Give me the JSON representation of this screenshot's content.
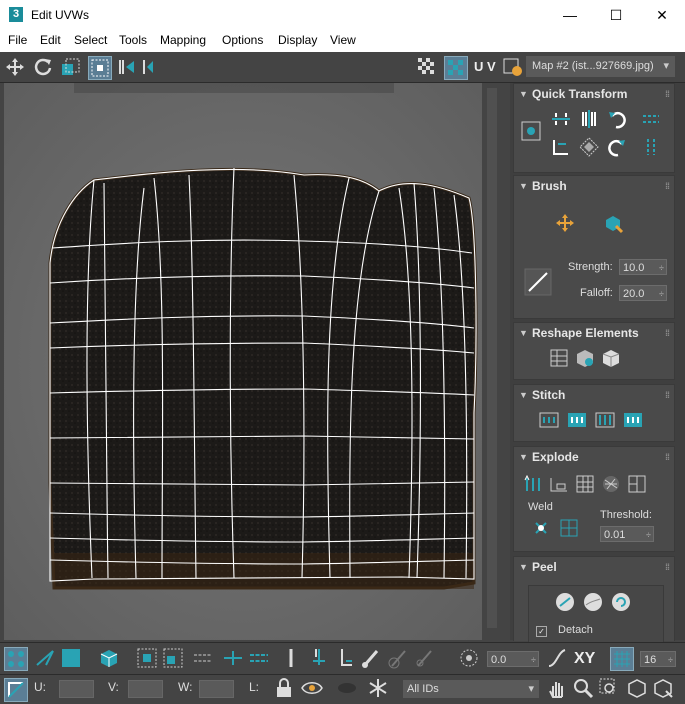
{
  "window": {
    "title": "Edit UVWs",
    "app_icon_label": "3",
    "minimize_glyph": "—",
    "maximize_glyph": "☐",
    "close_glyph": "✕"
  },
  "menu": [
    "File",
    "Edit",
    "Select",
    "Tools",
    "Mapping",
    "Options",
    "Display",
    "View"
  ],
  "toolbar": {
    "uv_label": "U V",
    "map_select": "Map #2 (ist...927669.jpg)"
  },
  "quick_transform": {
    "title": "Quick Transform"
  },
  "brush": {
    "title": "Brush",
    "strength_label": "Strength:",
    "strength_value": "10.0",
    "falloff_label": "Falloff:",
    "falloff_value": "20.0"
  },
  "reshape": {
    "title": "Reshape Elements"
  },
  "stitch": {
    "title": "Stitch"
  },
  "explode": {
    "title": "Explode",
    "weld_label": "Weld",
    "threshold_label": "Threshold:",
    "threshold_value": "0.01"
  },
  "peel": {
    "title": "Peel",
    "detach_label": "Detach"
  },
  "bottom": {
    "angle_value": "0.0",
    "xy_label": "XY",
    "grid_value": "16",
    "u_label": "U:",
    "v_label": "V:",
    "w_label": "W:",
    "l_label": "L:",
    "ids_select": "All IDs"
  },
  "colors": {
    "accent": "#29a3b4",
    "panel_bg": "#444444",
    "viewport_bg": "#6b6b6b",
    "mesh_line": "#ffffff"
  }
}
